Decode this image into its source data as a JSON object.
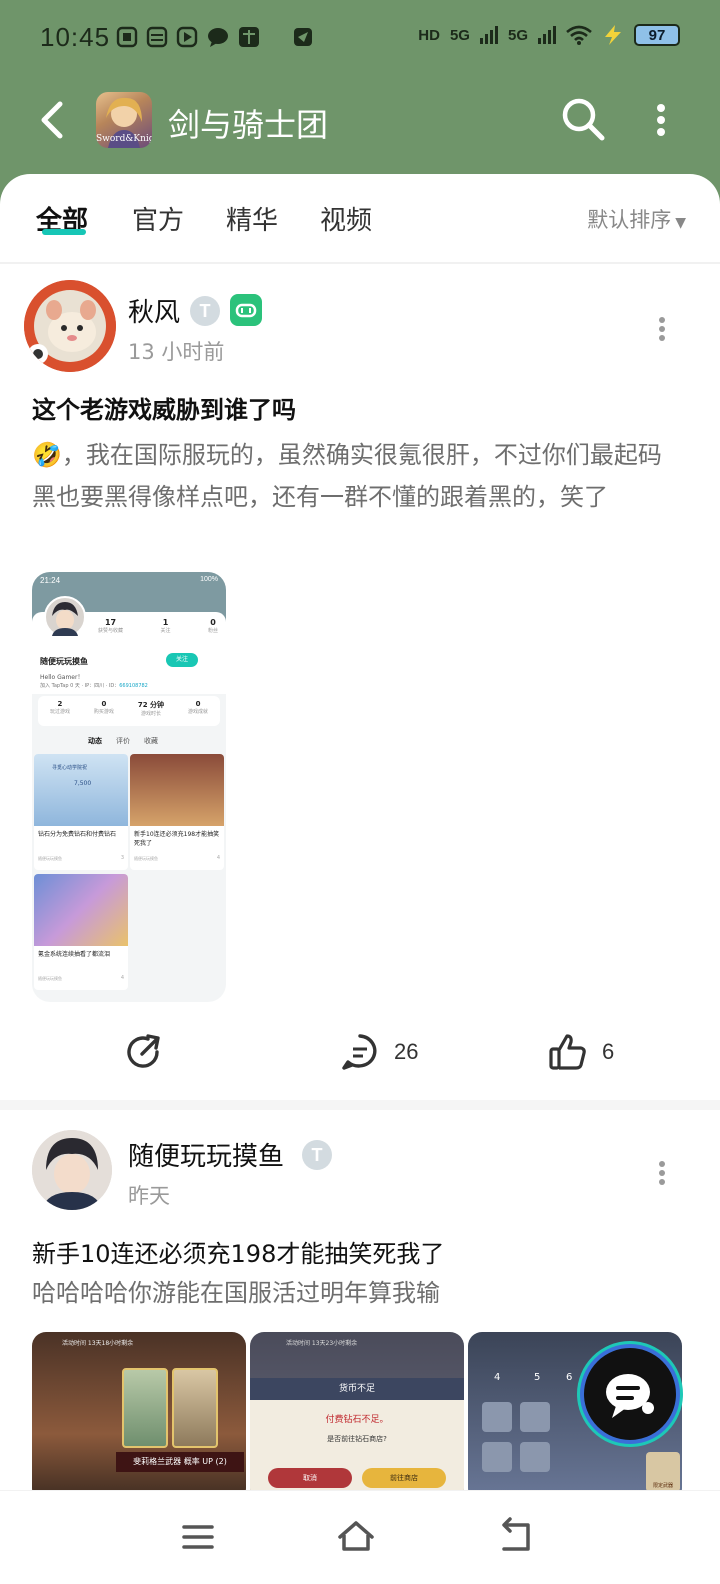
{
  "status_bar": {
    "time": "10:45",
    "network_labels": [
      "HD",
      "5G",
      "5G"
    ],
    "battery": "97",
    "icon_names": [
      "hd-icon",
      "signal-icon",
      "wifi-icon",
      "battery-icon"
    ]
  },
  "header": {
    "game_title": "剑与骑士团",
    "game_icon_text": "Sword&Knights"
  },
  "tabs": [
    {
      "label": "全部",
      "active": true
    },
    {
      "label": "官方",
      "active": false
    },
    {
      "label": "精华",
      "active": false
    },
    {
      "label": "视频",
      "active": false
    }
  ],
  "sort_label": "默认排序",
  "posts": [
    {
      "author": "秋风",
      "time": "13 小时前",
      "title": "这个老游戏威胁到谁了吗",
      "body": "🤣，我在国际服玩的，虽然确实很氪很肝，不过你们最起码黑也要黑得像样点吧，还有一群不懂的跟着黑的，笑了",
      "comments": "26",
      "likes": "6",
      "screenshot": {
        "time": "21:24",
        "battery": "100%",
        "stats": [
          {
            "value": "17",
            "label": "获赞与收藏"
          },
          {
            "value": "1",
            "label": "关注"
          },
          {
            "value": "0",
            "label": "粉丝"
          }
        ],
        "name": "随便玩玩摸鱼",
        "follow": "关注",
        "greeting": "Hello Gamer！",
        "info_pre": "加入 TapTap 0 天 · IP：四川 · ID：",
        "info_id": "669108782",
        "game_stats": [
          {
            "value": "2",
            "label": "玩过游戏"
          },
          {
            "value": "0",
            "label": "购买游戏"
          },
          {
            "value": "72 分钟",
            "label": "游戏时长"
          },
          {
            "value": "0",
            "label": "游戏成就"
          }
        ],
        "tabs": [
          "动态",
          "评价",
          "收藏"
        ],
        "mini_posts": [
          {
            "title": "钻石分为免费钻石和付费钻石",
            "author": "随便玩玩摸鱼",
            "likes": "3",
            "banner": "寻觅心动学院祝",
            "price": "7,500"
          },
          {
            "title": "新手10连还必须充198才能抽笑死我了",
            "author": "随便玩玩摸鱼",
            "likes": "4"
          },
          {
            "title": "氪金系统连续抽看了都流泪",
            "author": "随便玩玩摸鱼",
            "likes": "4"
          }
        ]
      }
    },
    {
      "author": "随便玩玩摸鱼",
      "time": "昨天",
      "title": "新手10连还必须充198才能抽笑死我了",
      "body": "哈哈哈哈你游能在国服活过明年算我输",
      "images": [
        {
          "top_text": "活动时间 13天18小时剩余",
          "caption": "斐莉格兰武器 概率 UP (2)"
        },
        {
          "top_text": "活动时间 13天23小时剩余",
          "title": "货币不足",
          "msg": "付费钻石不足。",
          "question": "是否前往钻石商店?",
          "cancel": "取消",
          "go": "前往商店"
        },
        {
          "numbers": [
            "4",
            "5",
            "6"
          ],
          "corner": "限定武器"
        }
      ]
    }
  ]
}
